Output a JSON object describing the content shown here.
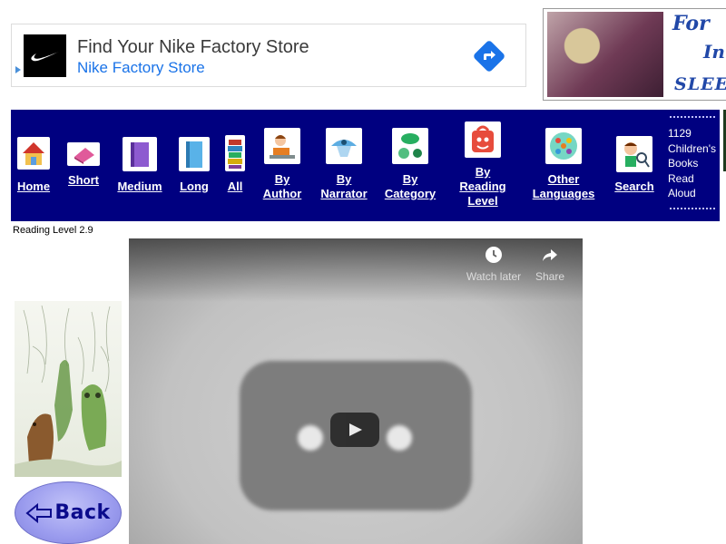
{
  "ad": {
    "headline": "Find Your Nike Factory Store",
    "brand": "Nike Factory Store"
  },
  "side_ad": {
    "line1": "For",
    "line2": "In",
    "line3": "SLEE"
  },
  "nav": {
    "items": [
      {
        "label": "Home",
        "icon": "house-icon"
      },
      {
        "label": "Short",
        "icon": "pink-book-icon"
      },
      {
        "label": "Medium",
        "icon": "purple-book-icon"
      },
      {
        "label": "Long",
        "icon": "blue-book-icon"
      },
      {
        "label": "All",
        "icon": "book-stack-icon"
      },
      {
        "label": "By\nAuthor",
        "icon": "author-icon"
      },
      {
        "label": "By\nNarrator",
        "icon": "narrator-icon"
      },
      {
        "label": "By\nCategory",
        "icon": "category-icon"
      },
      {
        "label": "By\nReading\nLevel",
        "icon": "reading-level-icon"
      },
      {
        "label": "Other\nLanguages",
        "icon": "globe-icon"
      },
      {
        "label": "Search",
        "icon": "search-kid-icon"
      }
    ],
    "count_text": "1129 Children's Books Read Aloud"
  },
  "reading_level": "Reading Level 2.9",
  "video": {
    "watch_later": "Watch later",
    "share": "Share"
  },
  "back_label": "Back",
  "colors": {
    "nav_bg": "#000080",
    "ad_link": "#1a73e8",
    "back_button": "#9a9bee"
  }
}
